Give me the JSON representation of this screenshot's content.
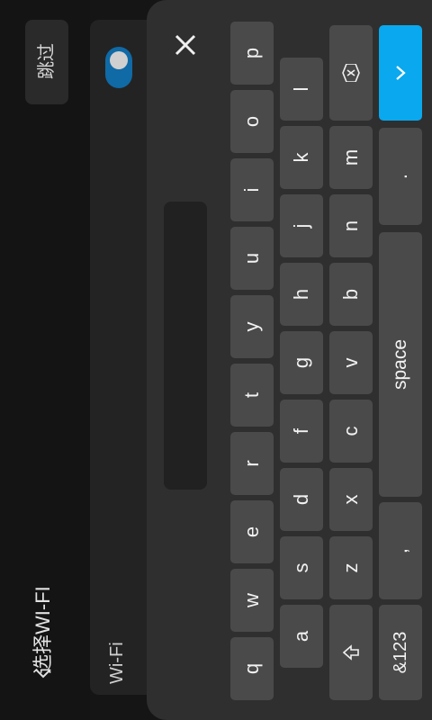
{
  "header": {
    "title": "选择WI-FI",
    "skip_label": "跳过"
  },
  "wifi": {
    "label": "Wi-Fi",
    "enabled": true
  },
  "keyboard": {
    "row1": [
      "q",
      "w",
      "e",
      "r",
      "t",
      "y",
      "u",
      "i",
      "o",
      "p"
    ],
    "row2": [
      "a",
      "s",
      "d",
      "f",
      "g",
      "h",
      "j",
      "k",
      "l"
    ],
    "row3": [
      "z",
      "x",
      "c",
      "v",
      "b",
      "n",
      "m"
    ],
    "num_key_label": "&123",
    "comma_label": ",",
    "space_label": "space",
    "period_label": ".",
    "accent_color": "#0aa8ee"
  },
  "icons": {
    "back": "chevron-left-icon",
    "close": "close-icon",
    "shift": "shift-icon",
    "backspace": "backspace-icon",
    "enter": "chevron-right-icon"
  }
}
